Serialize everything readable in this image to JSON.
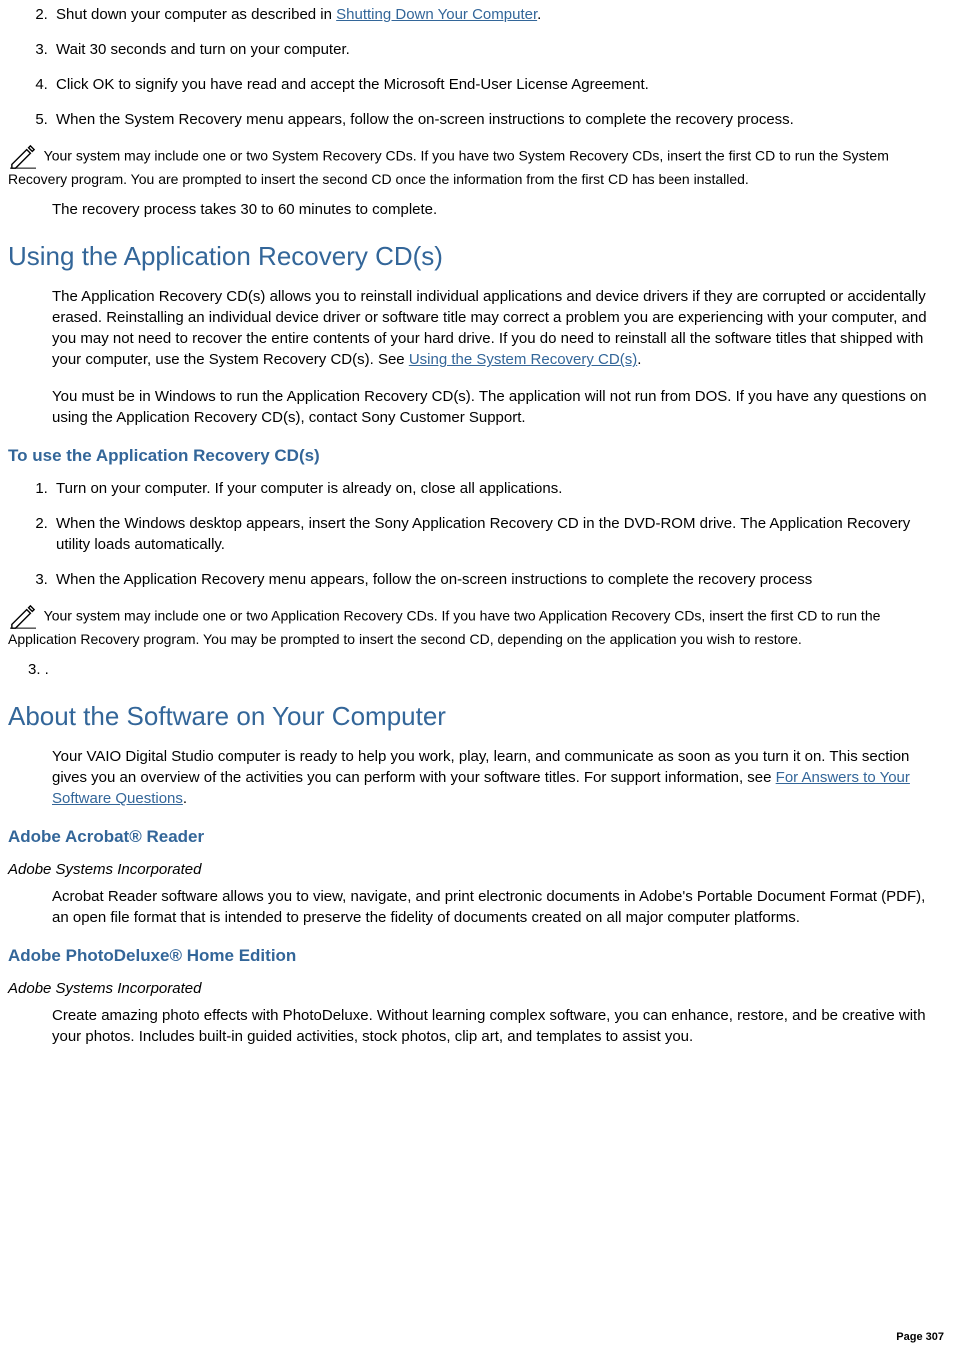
{
  "list1": {
    "start": 2,
    "items": [
      {
        "prefix": "Shut down your computer as described in ",
        "link": "Shutting Down Your Computer",
        "suffix": "."
      },
      {
        "text": "Wait 30 seconds and turn on your computer."
      },
      {
        "text": "Click OK to signify you have read and accept the Microsoft End-User License Agreement."
      },
      {
        "text": "When the System Recovery menu appears, follow the on-screen instructions to complete the recovery process."
      }
    ]
  },
  "note1": "Your system may include one or two System Recovery CDs. If you have two System Recovery CDs, insert the first CD to run the System Recovery program. You are prompted to insert the second CD once the information from the first CD has been installed.",
  "note1b": "The recovery process takes 30 to 60 minutes to complete.",
  "section1": {
    "heading": "Using the Application Recovery CD(s)",
    "para1_prefix": "The Application Recovery CD(s) allows you to reinstall individual applications and device drivers if they are corrupted or accidentally erased. Reinstalling an individual device driver or software title may correct a problem you are experiencing with your computer, and you may not need to recover the entire contents of your hard drive. If you do need to reinstall all the software titles that shipped with your computer, use the System Recovery CD(s). See ",
    "para1_link": "Using the System Recovery CD(s)",
    "para1_suffix": ".",
    "para2": "You must be in Windows to run the Application Recovery CD(s). The application will not run from DOS. If you have any questions on using the Application Recovery CD(s), contact Sony Customer Support.",
    "subheading": "To use the Application Recovery CD(s)",
    "steps": [
      "Turn on your computer. If your computer is already on, close all applications.",
      "When the Windows desktop appears, insert the Sony Application Recovery CD in the DVD-ROM drive. The Application Recovery utility loads automatically.",
      "When the Application Recovery menu appears, follow the on-screen instructions to complete the recovery process"
    ],
    "note": "Your system may include one or two Application Recovery CDs. If you have two Application Recovery CDs, insert the first CD to run the Application Recovery program. You may be prompted to insert the second CD, depending on the application you wish to restore."
  },
  "num3_label": "3.   .",
  "section2": {
    "heading": "About the Software on Your Computer",
    "para_prefix": "Your VAIO Digital Studio computer is ready to help you work, play, learn, and communicate as soon as you turn it on. This section gives you an overview of the activities you can perform with your software titles. For support information, see ",
    "para_link": "For Answers to Your Software Questions",
    "para_suffix": "."
  },
  "software": [
    {
      "title": "Adobe Acrobat® Reader",
      "vendor": "Adobe Systems Incorporated",
      "desc": "Acrobat Reader software allows you to view, navigate, and print electronic documents in Adobe's Portable Document Format (PDF), an open file format that is intended to preserve the fidelity of documents created on all major computer platforms."
    },
    {
      "title": "Adobe PhotoDeluxe® Home Edition",
      "vendor": "Adobe Systems Incorporated",
      "desc": "Create amazing photo effects with PhotoDeluxe. Without learning complex software, you can enhance, restore, and be creative with your photos. Includes built-in guided activities, stock photos, clip art, and templates to assist you."
    }
  ],
  "page": "Page 307"
}
